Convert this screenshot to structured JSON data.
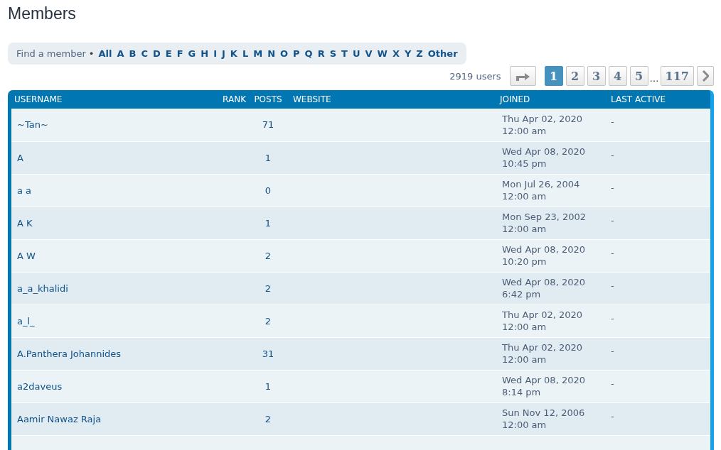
{
  "page_title": "Members",
  "filter": {
    "label": "Find a member",
    "separator": "•",
    "letters": [
      {
        "label": "All",
        "selected": false
      },
      {
        "label": "A",
        "selected": false
      },
      {
        "label": "B",
        "selected": false
      },
      {
        "label": "C",
        "selected": false
      },
      {
        "label": "D",
        "selected": false
      },
      {
        "label": "E",
        "selected": false
      },
      {
        "label": "F",
        "selected": false
      },
      {
        "label": "G",
        "selected": false
      },
      {
        "label": "H",
        "selected": false
      },
      {
        "label": "I",
        "selected": false
      },
      {
        "label": "J",
        "selected": false
      },
      {
        "label": "K",
        "selected": false
      },
      {
        "label": "L",
        "selected": false
      },
      {
        "label": "M",
        "selected": false
      },
      {
        "label": "N",
        "selected": false
      },
      {
        "label": "O",
        "selected": false
      },
      {
        "label": "P",
        "selected": false
      },
      {
        "label": "Q",
        "selected": false
      },
      {
        "label": "R",
        "selected": false
      },
      {
        "label": "S",
        "selected": false
      },
      {
        "label": "T",
        "selected": false
      },
      {
        "label": "U",
        "selected": false
      },
      {
        "label": "V",
        "selected": false
      },
      {
        "label": "W",
        "selected": false
      },
      {
        "label": "X",
        "selected": false
      },
      {
        "label": "Y",
        "selected": false
      },
      {
        "label": "Z",
        "selected": false
      },
      {
        "label": "Other",
        "selected": false
      }
    ]
  },
  "pagination": {
    "count": "2919 users",
    "pages": [
      {
        "kind": "page",
        "label": "1",
        "selected": true
      },
      {
        "kind": "page",
        "label": "2",
        "selected": false
      },
      {
        "kind": "page",
        "label": "3",
        "selected": false
      },
      {
        "kind": "page",
        "label": "4",
        "selected": false
      },
      {
        "kind": "page",
        "label": "5",
        "selected": false
      },
      {
        "kind": "ellipsis",
        "label": "…"
      },
      {
        "kind": "page",
        "label": "117",
        "selected": false
      }
    ]
  },
  "table": {
    "columns": [
      "USERNAME",
      "RANK",
      "POSTS",
      "WEBSITE",
      "JOINED",
      "LAST ACTIVE"
    ],
    "rows": [
      {
        "username": "~Tan~",
        "posts": "71",
        "joined": [
          "Thu Apr 02, 2020",
          "12:00 am"
        ],
        "last_active": "-"
      },
      {
        "username": "A",
        "posts": "1",
        "joined": [
          "Wed Apr 08, 2020",
          "10:45 pm"
        ],
        "last_active": "-"
      },
      {
        "username": "a a",
        "posts": "0",
        "joined": [
          "Mon Jul 26, 2004",
          "12:00 am"
        ],
        "last_active": "-"
      },
      {
        "username": "A K",
        "posts": "1",
        "joined": [
          "Mon Sep 23, 2002",
          "12:00 am"
        ],
        "last_active": "-"
      },
      {
        "username": "A W",
        "posts": "2",
        "joined": [
          "Wed Apr 08, 2020",
          "10:20 pm"
        ],
        "last_active": "-"
      },
      {
        "username": "a_a_khalidi",
        "posts": "2",
        "joined": [
          "Wed Apr 08, 2020",
          "6:42 pm"
        ],
        "last_active": "-"
      },
      {
        "username": "a_l_",
        "posts": "2",
        "joined": [
          "Thu Apr 02, 2020",
          "12:00 am"
        ],
        "last_active": "-"
      },
      {
        "username": "A.Panthera Johannides",
        "posts": "31",
        "joined": [
          "Thu Apr 02, 2020",
          "12:00 am"
        ],
        "last_active": "-"
      },
      {
        "username": "a2daveus",
        "posts": "1",
        "joined": [
          "Wed Apr 08, 2020",
          "8:14 pm"
        ],
        "last_active": "-"
      },
      {
        "username": "Aamir Nawaz Raja",
        "posts": "2",
        "joined": [
          "Sun Nov 12, 2006",
          "12:00 am"
        ],
        "last_active": "-"
      }
    ]
  }
}
